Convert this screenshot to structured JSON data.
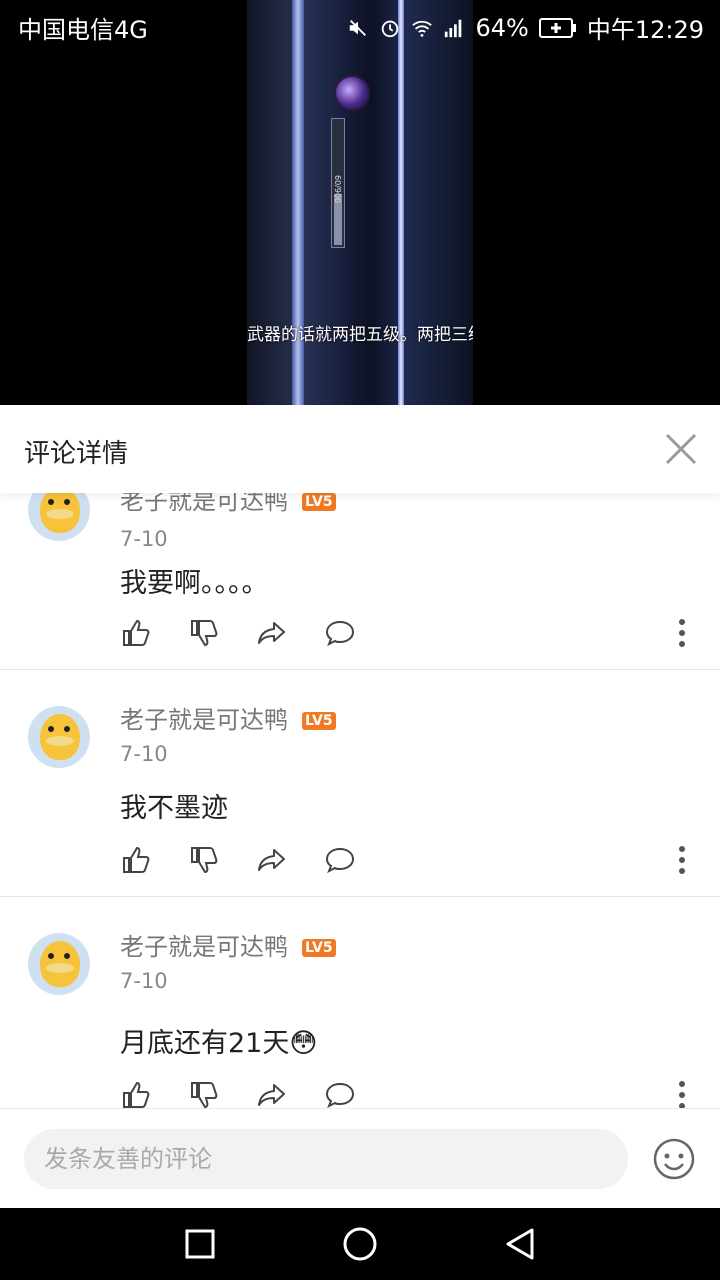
{
  "status_bar": {
    "carrier": "中国电信4G",
    "battery": "64%",
    "time": "中午12:29",
    "icons": [
      "mute-icon",
      "alarm-icon",
      "wifi-icon",
      "signal-icon",
      "battery-icon"
    ]
  },
  "video": {
    "subtitle": "武器的话就两把五级。两把三级",
    "bar_value": "60/900"
  },
  "panel": {
    "title": "评论详情",
    "close_icon": "close-icon"
  },
  "comments": [
    {
      "username": "老子就是可达鸭",
      "level": "LV5",
      "date": "7-10",
      "text": "我要啊。。。。"
    },
    {
      "username": "老子就是可达鸭",
      "level": "LV5",
      "date": "7-10",
      "text": "我不墨迹"
    },
    {
      "username": "老子就是可达鸭",
      "level": "LV5",
      "date": "7-10",
      "text": "月底还有21天😳"
    }
  ],
  "input": {
    "placeholder": "发条友善的评论"
  },
  "colors": {
    "badge": "#f07a23",
    "text_secondary": "#777777",
    "divider": "#e5e5e5"
  }
}
